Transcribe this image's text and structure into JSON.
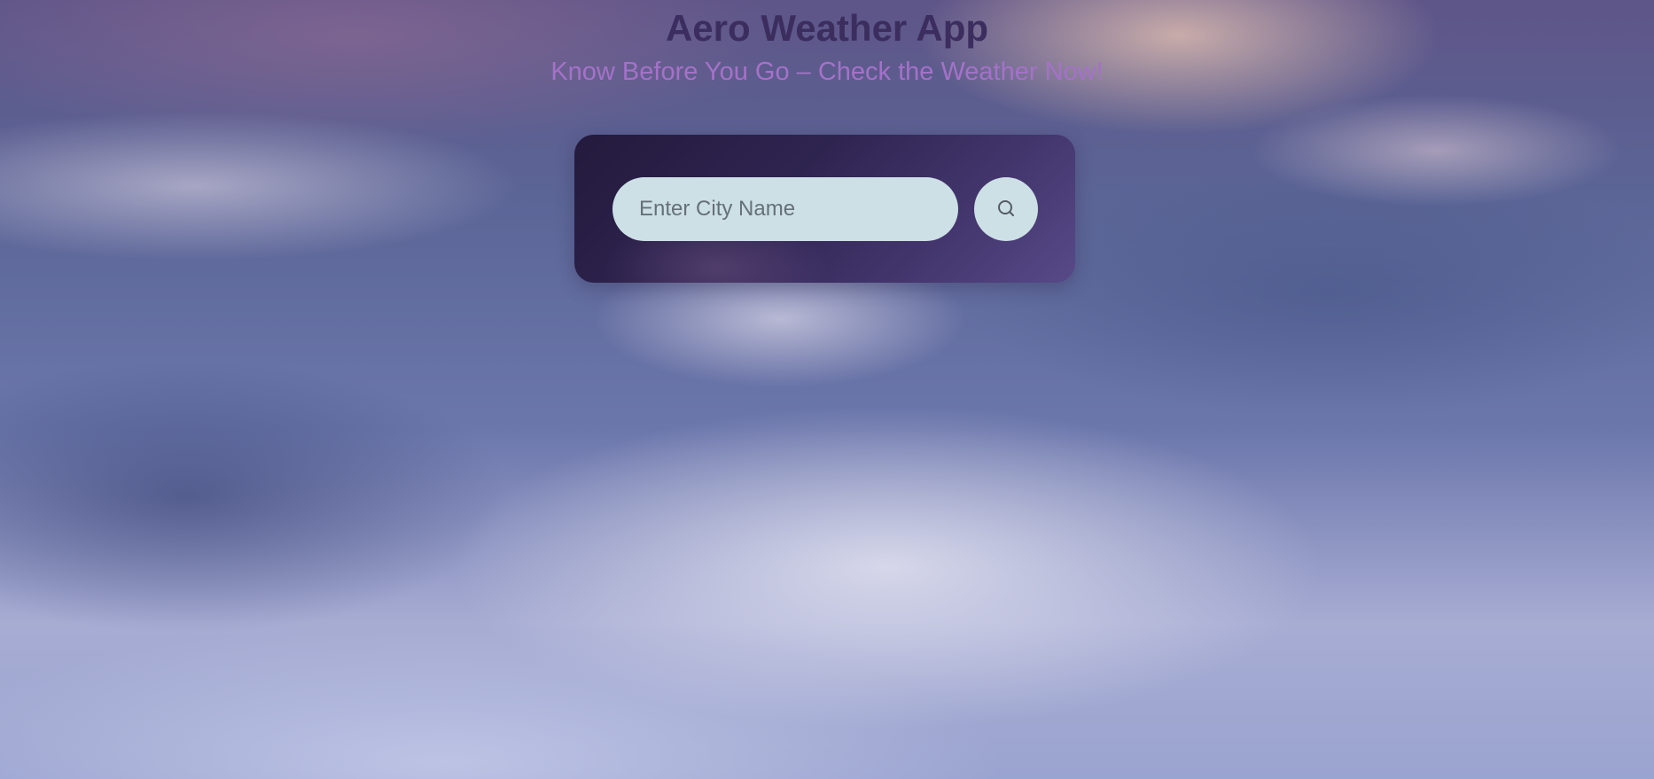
{
  "header": {
    "title": "Aero Weather App",
    "subtitle": "Know Before You Go – Check the Weather Now!"
  },
  "search": {
    "placeholder": "Enter City Name",
    "value": "",
    "button_icon": "search-icon"
  },
  "colors": {
    "title": "#3c2d5f",
    "subtitle": "#a472c8",
    "input_background": "#cde0e6",
    "card_background": "#2e2450"
  }
}
